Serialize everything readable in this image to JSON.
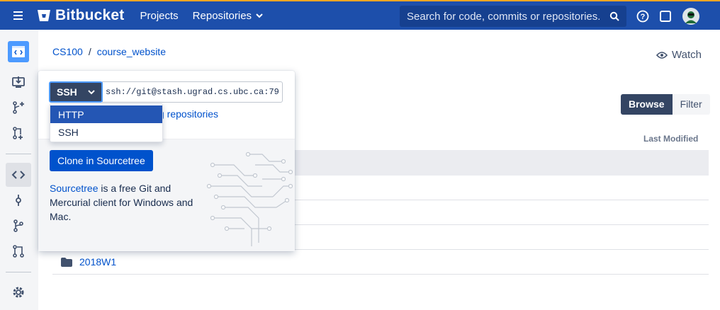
{
  "header": {
    "logo": "Bitbucket",
    "nav": [
      "Projects",
      "Repositories"
    ],
    "search_placeholder": "Search for code, commits or repositories..."
  },
  "sidebar": {
    "icons": [
      "repository-icon",
      "clone-icon",
      "create-branch-icon",
      "create-pull-request-icon",
      "source-icon",
      "commits-icon",
      "branches-icon",
      "pull-requests-icon",
      "settings-icon"
    ]
  },
  "breadcrumb": {
    "project": "CS100",
    "separator": "/",
    "repo": "course_website"
  },
  "actions": {
    "watch": "Watch",
    "browse": "Browse",
    "filter": "Filter"
  },
  "table": {
    "last_modified_header": "Last Modified",
    "rows": [
      {
        "type": "folder",
        "name": "2018W1"
      }
    ]
  },
  "clone": {
    "protocol": "SSH",
    "url": "ssh://git@stash.ugrad.cs.ubc.ca:79",
    "link_partial": "g repositories",
    "dropdown_options": [
      "HTTP",
      "SSH"
    ],
    "sourcetree_button": "Clone in Sourcetree",
    "sourcetree_link": "Sourcetree",
    "sourcetree_desc": " is a free Git and Mercurial client for Windows and Mac."
  },
  "colors": {
    "header_bg": "#1d4fab",
    "accent": "#0052cc",
    "dark_button": "#344563"
  }
}
